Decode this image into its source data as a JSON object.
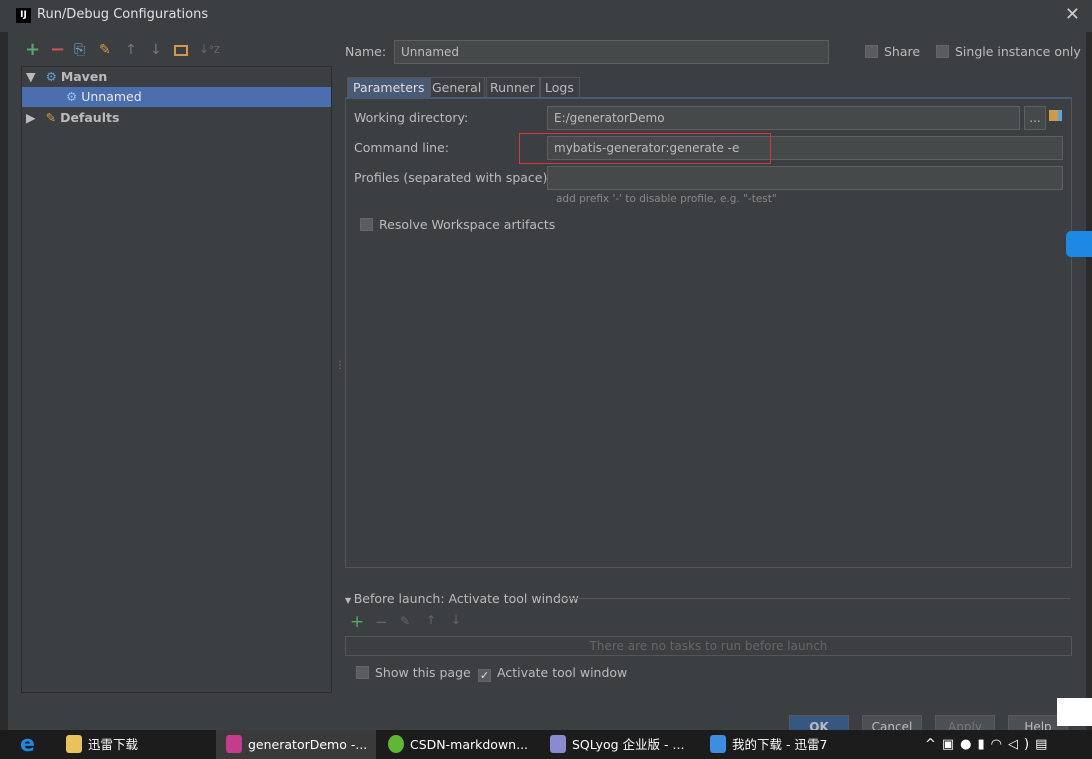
{
  "window": {
    "title": "Run/Debug Configurations",
    "logo": "IJ",
    "close": "✕"
  },
  "toolbar": {
    "add": "+",
    "remove": "−",
    "copy": "⎘",
    "edit_defaults": "wrench-icon",
    "up": "↑",
    "down": "↓",
    "folder": "folder-icon",
    "sort": "↓ᵃz"
  },
  "tree": {
    "maven": "Maven",
    "unnamed": "Unnamed",
    "defaults": "Defaults"
  },
  "form": {
    "name_label": "Name:",
    "name_value": "Unnamed",
    "share": "Share",
    "single_instance": "Single instance only"
  },
  "tabs": [
    "Parameters",
    "General",
    "Runner",
    "Logs"
  ],
  "params": {
    "working_dir_label": "Working directory:",
    "working_dir_value": "E:/generatorDemo",
    "browse": "...",
    "command_label": "Command line:",
    "command_value": "mybatis-generator:generate -e",
    "profiles_label": "Profiles (separated with space):",
    "profiles_value": "",
    "profiles_hint": "add prefix '-' to disable profile, e.g. \"-test\"",
    "resolve_workspace": "Resolve Workspace artifacts"
  },
  "before_launch": {
    "title": "Before launch: Activate tool window",
    "empty": "There are no tasks to run before launch",
    "show_page": "Show this page",
    "activate": "Activate tool window"
  },
  "buttons": {
    "ok": "OK",
    "cancel": "Cancel",
    "apply": "Apply",
    "help": "Help"
  },
  "taskbar": {
    "items": [
      "迅雷下载",
      "generatorDemo -...",
      "CSDN-markdown...",
      "SQLyog 企业版 - ...",
      "我的下载 - 迅雷7"
    ]
  },
  "colors": {
    "accent": "#4b6eaf",
    "highlight_box": "#d9363e",
    "add": "#59a869"
  }
}
